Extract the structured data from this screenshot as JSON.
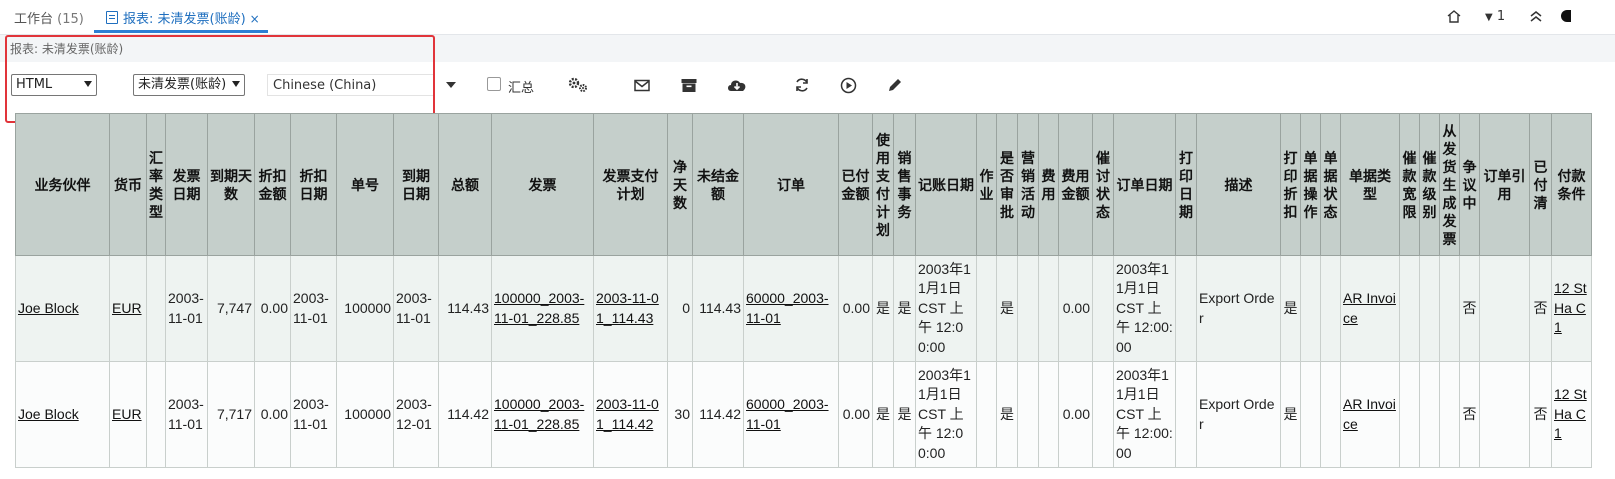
{
  "tabs": {
    "workbench_label": "工作台",
    "workbench_count": "(15)",
    "report_label": "报表: 未清发票(账龄)",
    "close_symbol": "×",
    "notif_count": "1"
  },
  "title": "报表: 未清发票(账龄)",
  "toolbar": {
    "format_value": "HTML",
    "report_value": "未清发票(账龄)",
    "language_value": "Chinese (China)",
    "summary_label": "汇总",
    "icons": [
      "settings-icon",
      "mail-icon",
      "archive-icon",
      "cloud-download-icon",
      "refresh-icon",
      "play-icon",
      "edit-icon"
    ]
  },
  "colors": {
    "accent": "#2d7fd3",
    "highlight": "#e1343a",
    "header_bg": "#c5cfcb"
  },
  "table": {
    "columns": [
      "业务伙伴",
      "货币",
      "汇率类型",
      "发票日期",
      "到期天数",
      "折扣金额",
      "折扣日期",
      "单号",
      "到期日期",
      "总额",
      "发票",
      "发票支付计划",
      "净天数",
      "未结金额",
      "订单",
      "已付金额",
      "使用支付计划",
      "销售事务",
      "记账日期",
      "作业",
      "是否审批",
      "营销活动",
      "费用",
      "费用金额",
      "催讨状态",
      "订单日期",
      "打印日期",
      "描述",
      "打印折扣",
      "单据操作",
      "单据状态",
      "单据类型",
      "催款宽限",
      "催款级别",
      "从发货生成发票",
      "争议中",
      "订单引用",
      "已付清",
      "付款条件"
    ],
    "rows": [
      [
        "Joe Block",
        "EUR",
        "",
        "2003-11-01",
        "7,747",
        "0.00",
        "2003-11-01",
        "100000",
        "2003-11-01",
        "114.43",
        "100000_2003-11-01_228.85",
        "2003-11-01_114.43",
        "0",
        "114.43",
        "60000_2003-11-01",
        "0.00",
        "是",
        "是",
        "2003年11月1日 CST 上午 12:00:00",
        "",
        "是",
        "",
        "",
        "0.00",
        "",
        "2003年11月1日 CST 上午 12:00:00",
        "",
        "Export Order",
        "是",
        "",
        "",
        "AR Invoice",
        "",
        "",
        "",
        "否",
        "",
        "否",
        "12 St Ha C1"
      ],
      [
        "Joe Block",
        "EUR",
        "",
        "2003-11-01",
        "7,717",
        "0.00",
        "2003-11-01",
        "100000",
        "2003-12-01",
        "114.42",
        "100000_2003-11-01_228.85",
        "2003-11-01_114.42",
        "30",
        "114.42",
        "60000_2003-11-01",
        "0.00",
        "是",
        "是",
        "2003年11月1日 CST 上午 12:00:00",
        "",
        "是",
        "",
        "",
        "0.00",
        "",
        "2003年11月1日 CST 上午 12:00:00",
        "",
        "Export Order",
        "是",
        "",
        "",
        "AR Invoice",
        "",
        "",
        "",
        "否",
        "",
        "否",
        "12 St Ha C1"
      ]
    ]
  }
}
